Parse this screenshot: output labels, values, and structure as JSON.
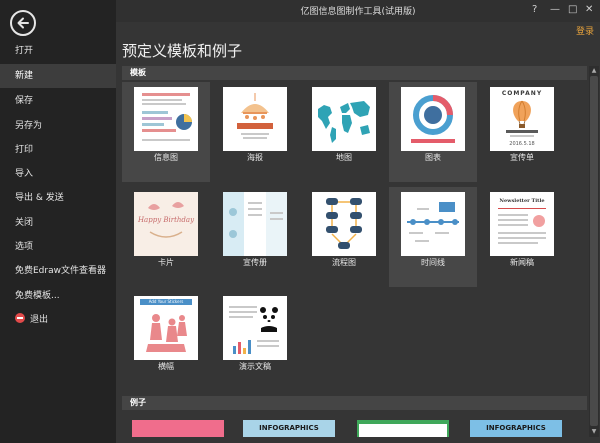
{
  "window": {
    "title": "亿图信息图制作工具(试用版)",
    "login": "登录",
    "controls": {
      "help": "?",
      "minimize": "—",
      "maximize": "□",
      "close": "✕"
    }
  },
  "sidebar": {
    "items": [
      {
        "label": "打开"
      },
      {
        "label": "新建"
      },
      {
        "label": "保存"
      },
      {
        "label": "另存为"
      },
      {
        "label": "打印"
      },
      {
        "label": "导入"
      },
      {
        "label": "导出 & 发送"
      },
      {
        "label": "关闭"
      },
      {
        "label": "选项"
      },
      {
        "label": "免费Edraw文件查看器"
      },
      {
        "label": "免费模板..."
      },
      {
        "label": "退出"
      }
    ],
    "active": "新建"
  },
  "main": {
    "title": "预定义模板和例子",
    "templates_section": "模板",
    "examples_section": "例子",
    "templates": [
      {
        "label": "信息图",
        "icon": "infographic-thumb"
      },
      {
        "label": "海报",
        "icon": "poster-thumb"
      },
      {
        "label": "地图",
        "icon": "map-thumb"
      },
      {
        "label": "图表",
        "icon": "chart-thumb"
      },
      {
        "label": "宣传单",
        "icon": "flyer-thumb"
      },
      {
        "label": "卡片",
        "icon": "card-thumb"
      },
      {
        "label": "宣传册",
        "icon": "brochure-thumb"
      },
      {
        "label": "流程图",
        "icon": "flowchart-thumb"
      },
      {
        "label": "时间线",
        "icon": "timeline-thumb"
      },
      {
        "label": "新闻稿",
        "icon": "press-release-thumb"
      },
      {
        "label": "横幅",
        "icon": "banner-thumb"
      },
      {
        "label": "演示文稿",
        "icon": "presentation-thumb"
      }
    ],
    "thumb_text": {
      "flyer_company": "COMPANY",
      "flyer_date": "2016.5.18",
      "card_script": "Happy Birthday",
      "press_title": "Newsletter Title",
      "banner_top": "Add Your Stickers"
    },
    "examples": [
      {
        "label": ""
      },
      {
        "label": "INFOGRAPHICS"
      },
      {
        "label": ""
      },
      {
        "label": "INFOGRAPHICS"
      }
    ]
  },
  "colors": {
    "sidebar_bg": "#232323",
    "main_bg": "#353535",
    "section_bg": "#454545",
    "accent": "#e6a23c",
    "exit": "#e24a4a"
  }
}
